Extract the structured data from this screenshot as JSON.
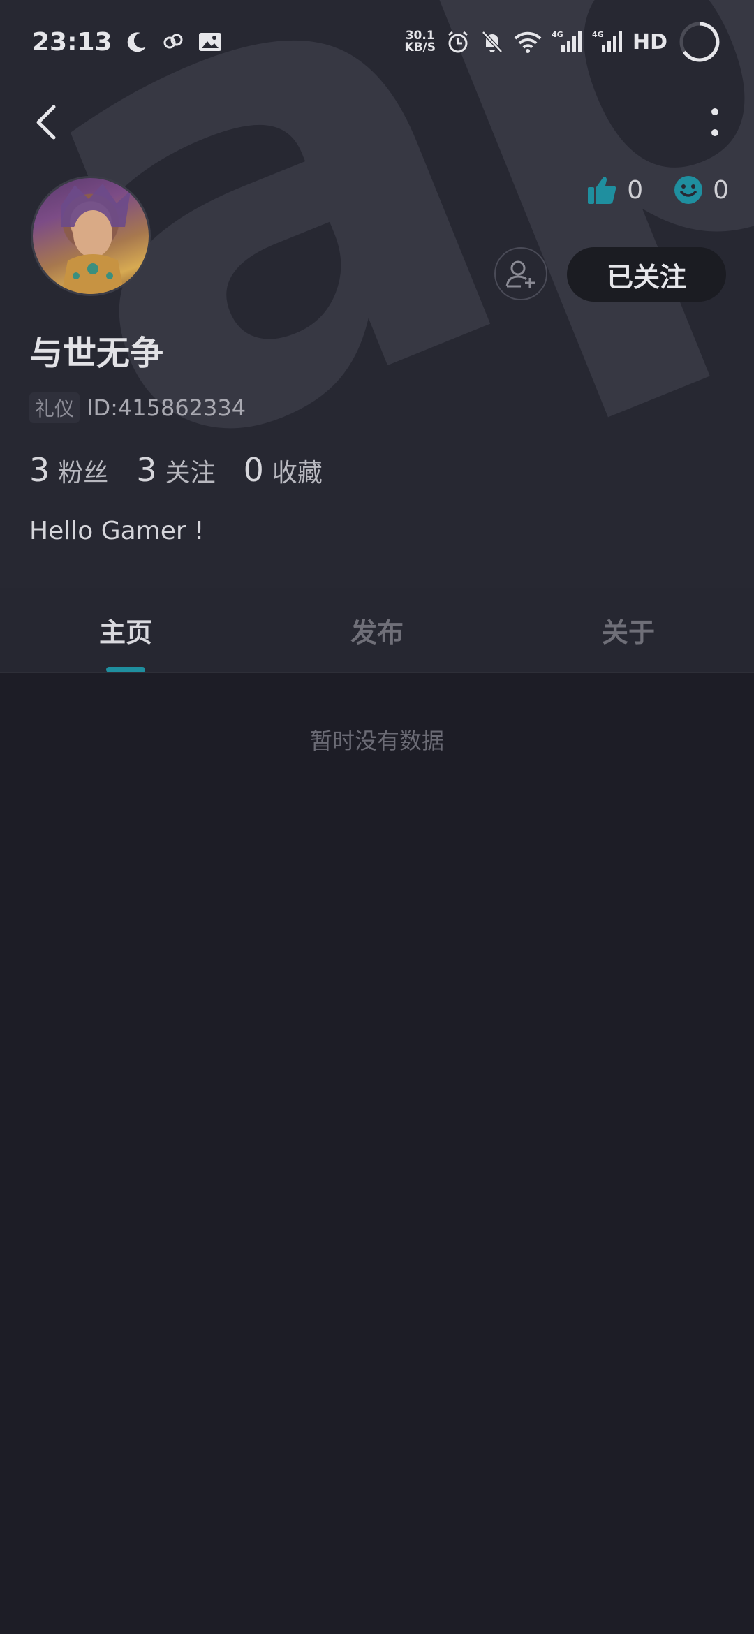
{
  "status_bar": {
    "time": "23:13",
    "net_speed_value": "30.1",
    "net_speed_unit": "KB/S",
    "network_1": "4G",
    "network_2": "4G",
    "hd": "HD"
  },
  "profile": {
    "likes": "0",
    "smiles": "0",
    "follow_button": "已关注",
    "username": "与世无争",
    "badge": "礼仪",
    "user_id": "ID:415862334",
    "followers_count": "3",
    "followers_label": "粉丝",
    "following_count": "3",
    "following_label": "关注",
    "favorites_count": "0",
    "favorites_label": "收藏",
    "bio": "Hello Gamer !"
  },
  "watermark": "apta",
  "tabs": [
    {
      "label": "主页",
      "active": true
    },
    {
      "label": "发布",
      "active": false
    },
    {
      "label": "关于",
      "active": false
    }
  ],
  "empty_state": "暂时没有数据",
  "colors": {
    "accent": "#1f8f9f",
    "background": "#1d1d26",
    "header_bg": "#272832"
  }
}
